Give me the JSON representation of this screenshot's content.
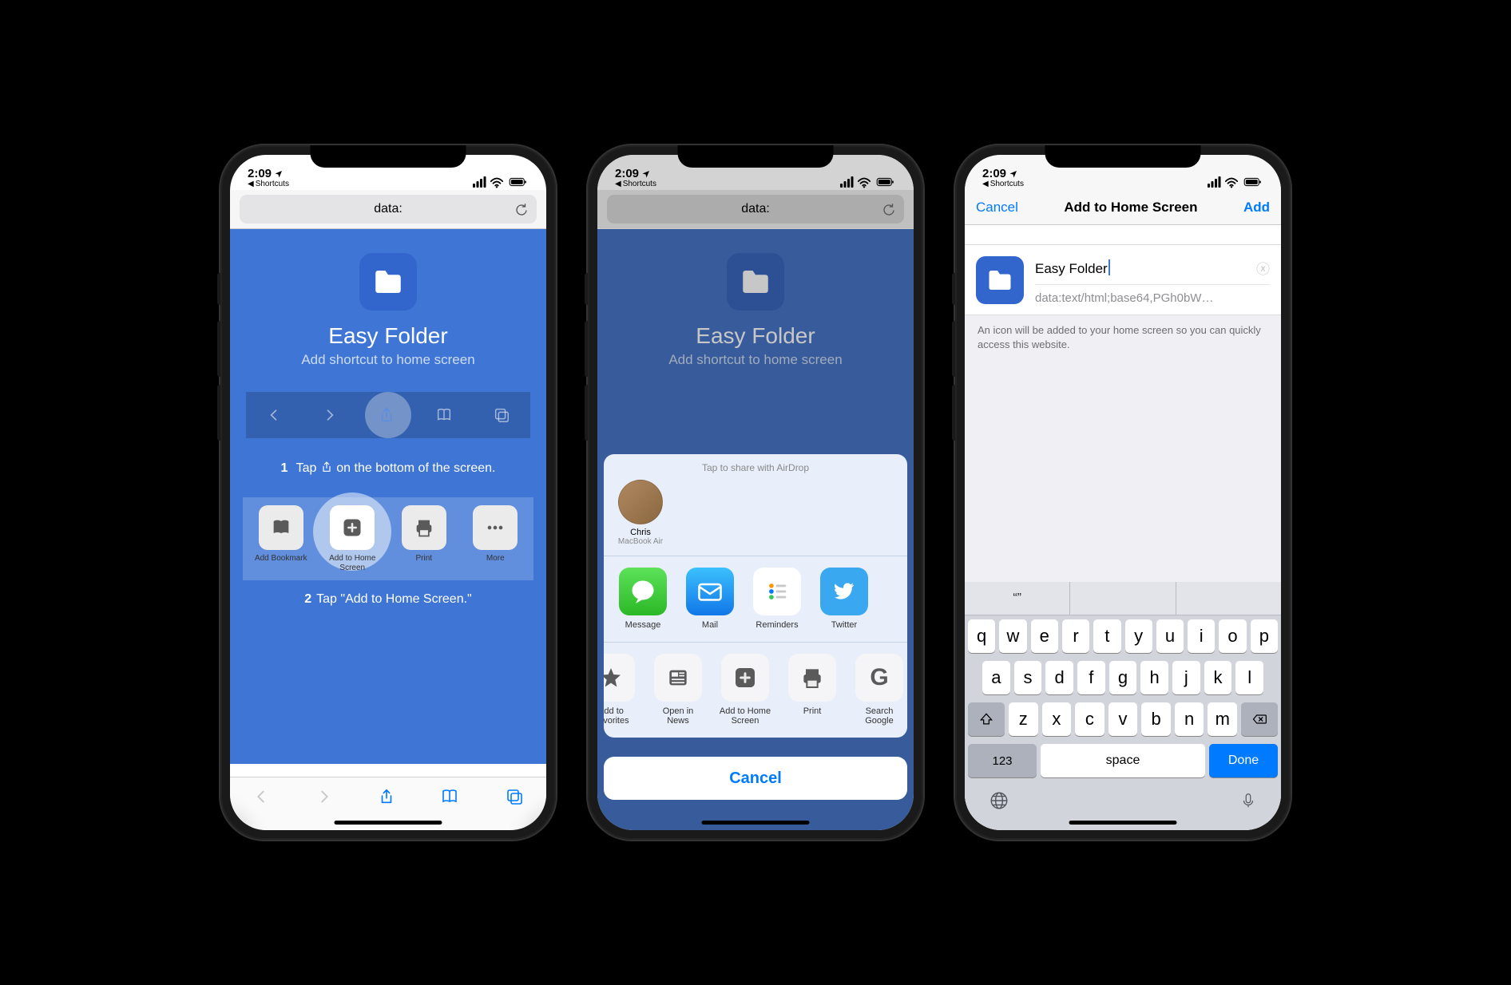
{
  "status": {
    "time": "2:09",
    "back_app": "Shortcuts"
  },
  "safari": {
    "url": "data:"
  },
  "phone1": {
    "title": "Easy Folder",
    "subtitle": "Add shortcut to home screen",
    "step1_num": "1",
    "step1_a": "Tap",
    "step1_b": "on the bottom of the screen.",
    "step2_num": "2",
    "step2": "Tap \"Add to Home Screen.\"",
    "actions": {
      "bookmark": "Add Bookmark",
      "home": "Add to Home Screen",
      "print": "Print",
      "more": "More"
    }
  },
  "phone2": {
    "airdrop_title": "Tap to share with AirDrop",
    "contact": {
      "name": "Chris",
      "device": "MacBook Air"
    },
    "apps": {
      "message": "Message",
      "mail": "Mail",
      "reminders": "Reminders",
      "twitter": "Twitter"
    },
    "actions": {
      "favorites": "Add to Favorites",
      "news": "Open in News",
      "home": "Add to Home Screen",
      "print": "Print",
      "google": "Search Google"
    },
    "cancel": "Cancel"
  },
  "phone3": {
    "cancel": "Cancel",
    "title": "Add to Home Screen",
    "add": "Add",
    "name_value": "Easy Folder",
    "url_value": "data:text/html;base64,PGh0bW…",
    "help": "An icon will be added to your home screen so you can quickly access this website.",
    "keyboard": {
      "suggest": "“”",
      "num": "123",
      "space": "space",
      "done": "Done"
    }
  }
}
